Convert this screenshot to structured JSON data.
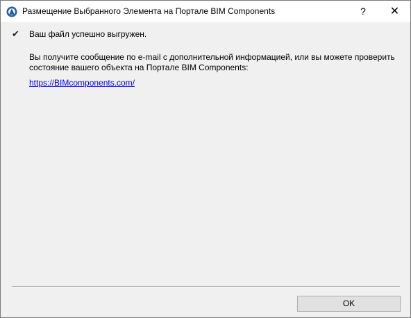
{
  "window": {
    "title": "Размещение Выбранного Элемента на Портале BIM Components",
    "icon": "archicad-app-icon",
    "help_label": "?",
    "close_label": "✕"
  },
  "content": {
    "check_icon": "✔",
    "success_message": "Ваш файл успешно выгружен.",
    "info_message": "Вы получите сообщение по e-mail с дополнительной информацией, или вы можете проверить состояние вашего объекта на Портале BIM Components:",
    "link_text": "https://BIMcomponents.com/"
  },
  "footer": {
    "ok_label": "OK"
  }
}
